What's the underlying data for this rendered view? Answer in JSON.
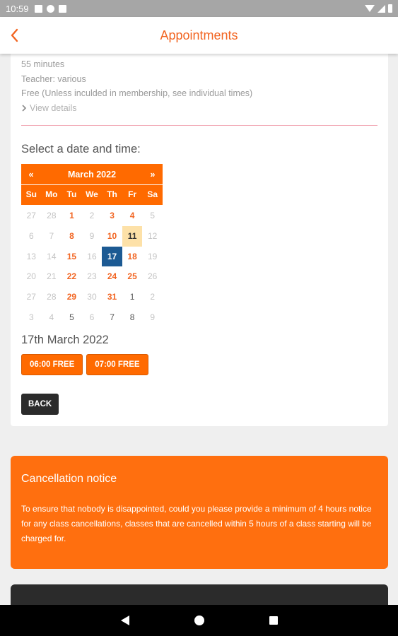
{
  "status_bar": {
    "time": "10:59",
    "icons": [
      "notification-square-icon",
      "theme-icon",
      "card-icon",
      "wifi-icon",
      "signal-icon",
      "battery-icon"
    ]
  },
  "app_bar": {
    "title": "Appointments",
    "back_icon": "chevron-left-icon",
    "accent_color": "#f26522"
  },
  "class_info": {
    "duration": "55 minutes",
    "teacher": "Teacher: various",
    "price": "Free (Unless inculded in membership, see individual times)",
    "view_details": "View details"
  },
  "booking": {
    "select_label": "Select a date and time:",
    "calendar": {
      "prev": "«",
      "next": "»",
      "month_label": "March 2022",
      "weekdays": [
        "Su",
        "Mo",
        "Tu",
        "We",
        "Th",
        "Fr",
        "Sa"
      ],
      "weeks": [
        [
          "27",
          "28",
          "1",
          "2",
          "3",
          "4",
          "5"
        ],
        [
          "6",
          "7",
          "8",
          "9",
          "10",
          "11",
          "12"
        ],
        [
          "13",
          "14",
          "15",
          "16",
          "17",
          "18",
          "19"
        ],
        [
          "20",
          "21",
          "22",
          "23",
          "24",
          "25",
          "26"
        ],
        [
          "27",
          "28",
          "29",
          "30",
          "31",
          "1",
          "2"
        ],
        [
          "3",
          "4",
          "5",
          "6",
          "7",
          "8",
          "9"
        ]
      ],
      "available_days": [
        "1",
        "3",
        "4",
        "8",
        "10",
        "15",
        "18",
        "22",
        "24",
        "25",
        "29",
        "31"
      ],
      "today": "11",
      "selected": "17",
      "header_color": "#ff6a00",
      "selected_color": "#1c5a93",
      "today_color": "#fde1a8"
    },
    "selected_date_label": "17th March 2022",
    "time_slots": [
      "06:00 FREE",
      "07:00 FREE"
    ],
    "back_label": "BACK"
  },
  "cancellation": {
    "title": "Cancellation notice",
    "body": "To ensure that nobody is disappointed, could you please provide a minimum of 4 hours notice for any class cancellations, classes that are cancelled within 5 hours of a class starting will be charged for.",
    "background_color": "#ff6f0f"
  },
  "nav_bar": {
    "icons": [
      "back-triangle-icon",
      "home-circle-icon",
      "recents-square-icon"
    ]
  }
}
